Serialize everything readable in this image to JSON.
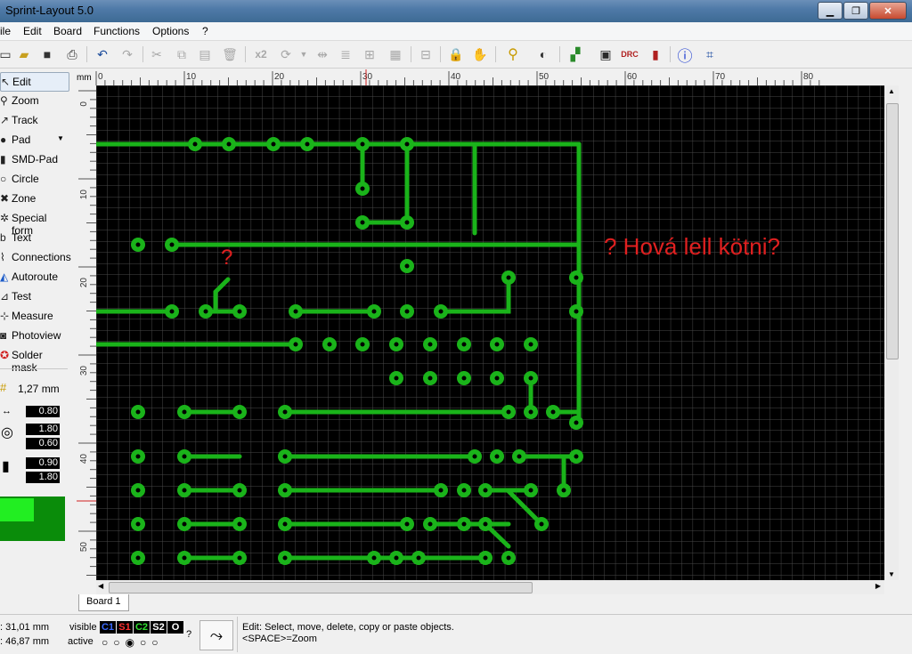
{
  "window": {
    "title": "Sprint-Layout 5.0",
    "minimize": "▁",
    "maximize": "❐",
    "close": "✕"
  },
  "menu": [
    "ile",
    "Edit",
    "Board",
    "Functions",
    "Options",
    "?"
  ],
  "toolbar": {
    "zoom_label": "x2"
  },
  "tools": [
    {
      "label": "Edit",
      "icon": "cursor-arrow-icon"
    },
    {
      "label": "Zoom",
      "icon": "magnifier-icon"
    },
    {
      "label": "Track",
      "icon": "track-icon"
    },
    {
      "label": "Pad",
      "icon": "pad-icon"
    },
    {
      "label": "SMD-Pad",
      "icon": "smd-pad-icon"
    },
    {
      "label": "Circle",
      "icon": "circle-icon"
    },
    {
      "label": "Zone",
      "icon": "zone-icon"
    },
    {
      "label": "Special form",
      "icon": "special-form-icon"
    },
    {
      "label": "Text",
      "icon": "text-icon"
    },
    {
      "label": "Connections",
      "icon": "connections-icon"
    },
    {
      "label": "Autoroute",
      "icon": "autoroute-icon"
    },
    {
      "label": "Test",
      "icon": "test-icon"
    },
    {
      "label": "Measure",
      "icon": "measure-icon"
    },
    {
      "label": "Photoview",
      "icon": "camera-icon"
    },
    {
      "label": "Solder mask",
      "icon": "solder-mask-icon"
    }
  ],
  "grid": {
    "label": "1,27 mm"
  },
  "values": {
    "track_width": "0.80",
    "pad_outer": "1.80",
    "pad_inner": "0.60",
    "smd_w": "0.90",
    "smd_h": "1.80"
  },
  "ruler": {
    "unit": "mm",
    "top_labels": [
      "0",
      "10",
      "20",
      "30",
      "40",
      "50",
      "60",
      "70",
      "80"
    ],
    "left_labels": [
      "0",
      "10",
      "20",
      "30",
      "40",
      "50"
    ]
  },
  "annotation": {
    "question_small": "?",
    "question_text": "? Hová lell kötni?"
  },
  "tab": {
    "label": "Board 1"
  },
  "status": {
    "x_coord": ": 31,01 mm",
    "y_coord": ": 46,87 mm",
    "visible_label": "visible",
    "active_label": "active",
    "layers": [
      "C1",
      "S1",
      "C2",
      "S2",
      "O"
    ],
    "help_mark": "?",
    "message1": "Edit: Select, move, delete, copy or paste objects.",
    "message2": "<SPACE>=Zoom"
  },
  "colors": {
    "copper": "#1ab31a",
    "board": "#000000",
    "grid": "#4a4a4a",
    "annotation": "#e02020",
    "accent": "#0aa30a"
  }
}
